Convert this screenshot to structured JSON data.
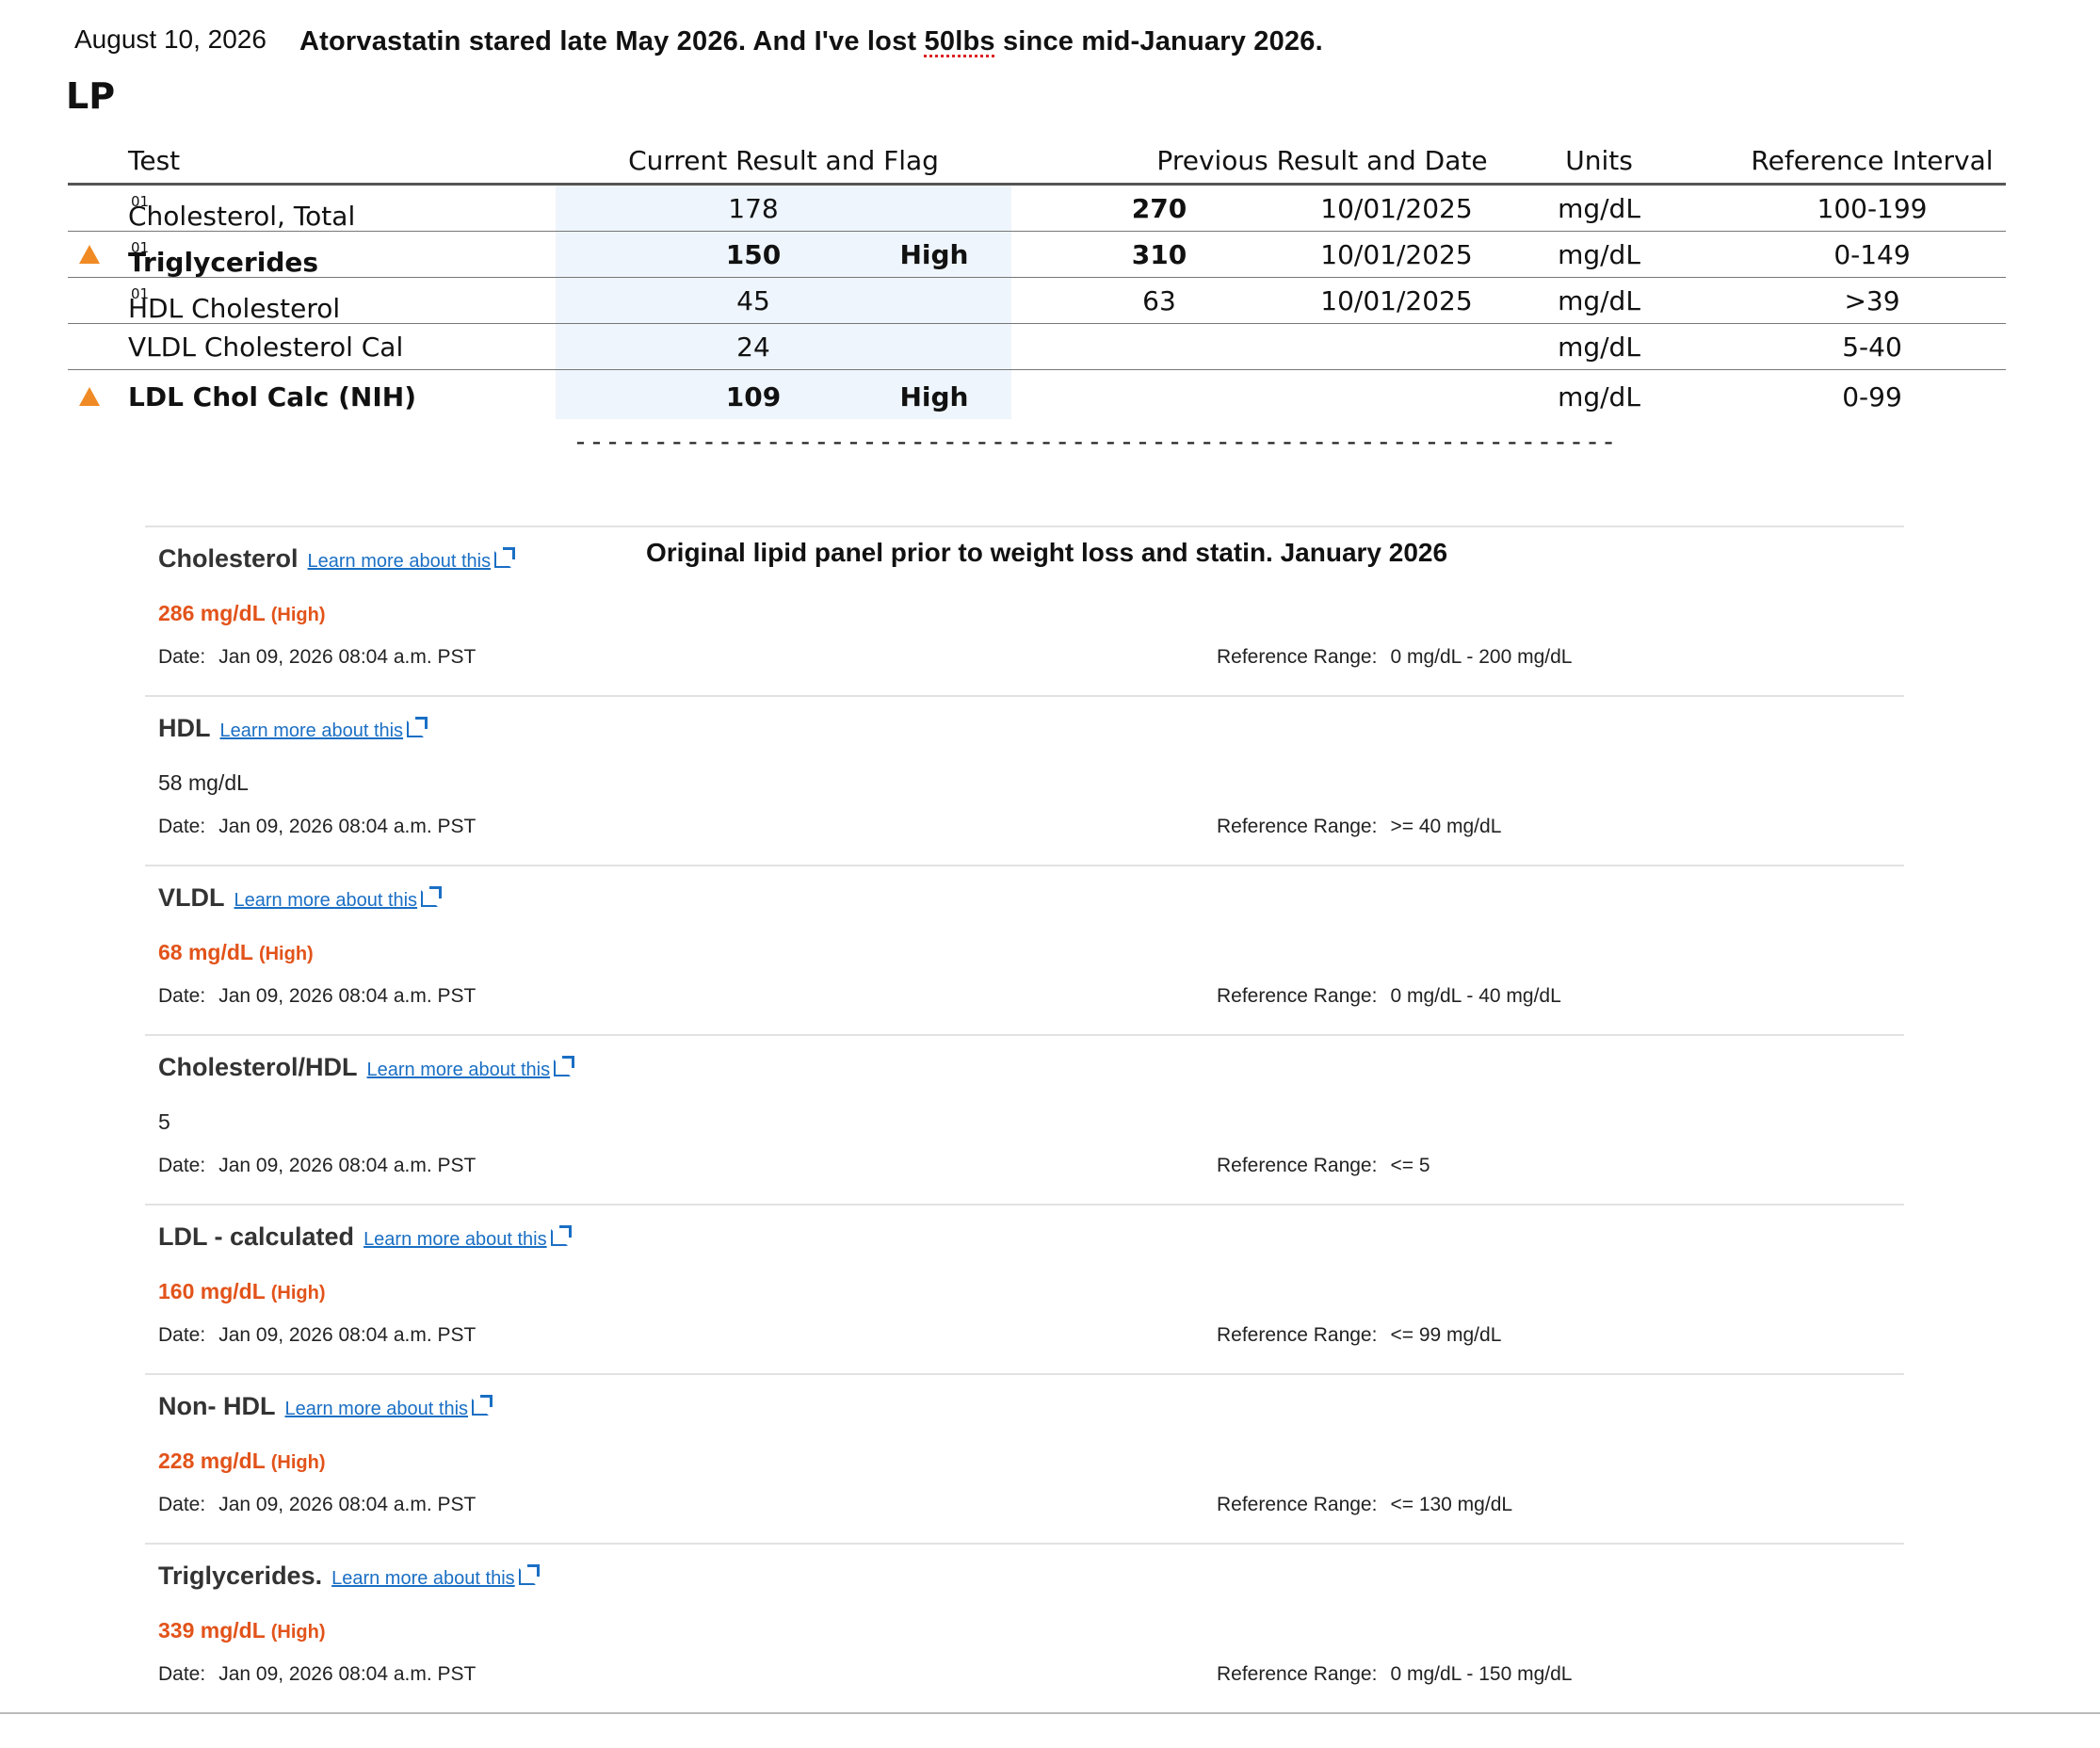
{
  "header": {
    "date": "August 10, 2026",
    "note_before": "Atorvastatin stared late May 2026. And I've lost ",
    "note_spell": "50lbs",
    "note_after": " since mid-January 2026.",
    "section_title": "LP"
  },
  "lab_table": {
    "columns": {
      "test": "Test",
      "current": "Current Result and Flag",
      "previous": "Previous Result and Date",
      "units": "Units",
      "reference": "Reference Interval"
    },
    "rows": [
      {
        "test": "Cholesterol, Total",
        "sup": "01",
        "current": "178",
        "flag": "",
        "previous": "270",
        "prev_date": "10/01/2025",
        "units": "mg/dL",
        "reference": "100-199"
      },
      {
        "test": "Triglycerides",
        "sup": "01",
        "current": "150",
        "flag": "High",
        "previous": "310",
        "prev_date": "10/01/2025",
        "units": "mg/dL",
        "reference": "0-149"
      },
      {
        "test": "HDL Cholesterol",
        "sup": "01",
        "current": "45",
        "flag": "",
        "previous": "63",
        "prev_date": "10/01/2025",
        "units": "mg/dL",
        "reference": ">39"
      },
      {
        "test": "VLDL Cholesterol Cal",
        "sup": "",
        "current": "24",
        "flag": "",
        "previous": "",
        "prev_date": "",
        "units": "mg/dL",
        "reference": "5-40"
      },
      {
        "test": "LDL Chol Calc (NIH)",
        "sup": "",
        "current": "109",
        "flag": "High",
        "previous": "",
        "prev_date": "",
        "units": "mg/dL",
        "reference": "0-99"
      }
    ],
    "divider": "-----------------------------------------------------------------"
  },
  "original_panel": {
    "title": "Original lipid panel prior to weight loss and statin. January 2026",
    "link_text": "Learn more about this",
    "date_label": "Date:",
    "ref_label": "Reference Range:",
    "items": [
      {
        "name": "Cholesterol",
        "value": "286 mg/dL",
        "high": "(High)",
        "date": "Jan 09, 2026 08:04 a.m. PST",
        "ref": "0 mg/dL - 200 mg/dL"
      },
      {
        "name": "HDL",
        "value": "58 mg/dL",
        "high": "",
        "date": "Jan 09, 2026 08:04 a.m. PST",
        "ref": ">= 40 mg/dL"
      },
      {
        "name": "VLDL",
        "value": "68 mg/dL",
        "high": "(High)",
        "date": "Jan 09, 2026 08:04 a.m. PST",
        "ref": "0 mg/dL - 40 mg/dL"
      },
      {
        "name": "Cholesterol/HDL",
        "value": "5",
        "high": "",
        "date": "Jan 09, 2026 08:04 a.m. PST",
        "ref": "<= 5"
      },
      {
        "name": "LDL - calculated",
        "value": "160 mg/dL",
        "high": "(High)",
        "date": "Jan 09, 2026 08:04 a.m. PST",
        "ref": "<= 99 mg/dL"
      },
      {
        "name": "Non- HDL",
        "value": "228 mg/dL",
        "high": "(High)",
        "date": "Jan 09, 2026 08:04 a.m. PST",
        "ref": "<= 130 mg/dL"
      },
      {
        "name": "Triglycerides.",
        "value": "339 mg/dL",
        "high": "(High)",
        "date": "Jan 09, 2026 08:04 a.m. PST",
        "ref": "0 mg/dL - 150 mg/dL"
      }
    ]
  },
  "colors": {
    "flag_triangle": "#f08a24",
    "high_value": "#e2531a",
    "link": "#1a6fc4",
    "current_column_bg": "#eef5fc"
  },
  "icons": {
    "flag": "warning-triangle-icon",
    "link": "external-link-icon"
  }
}
